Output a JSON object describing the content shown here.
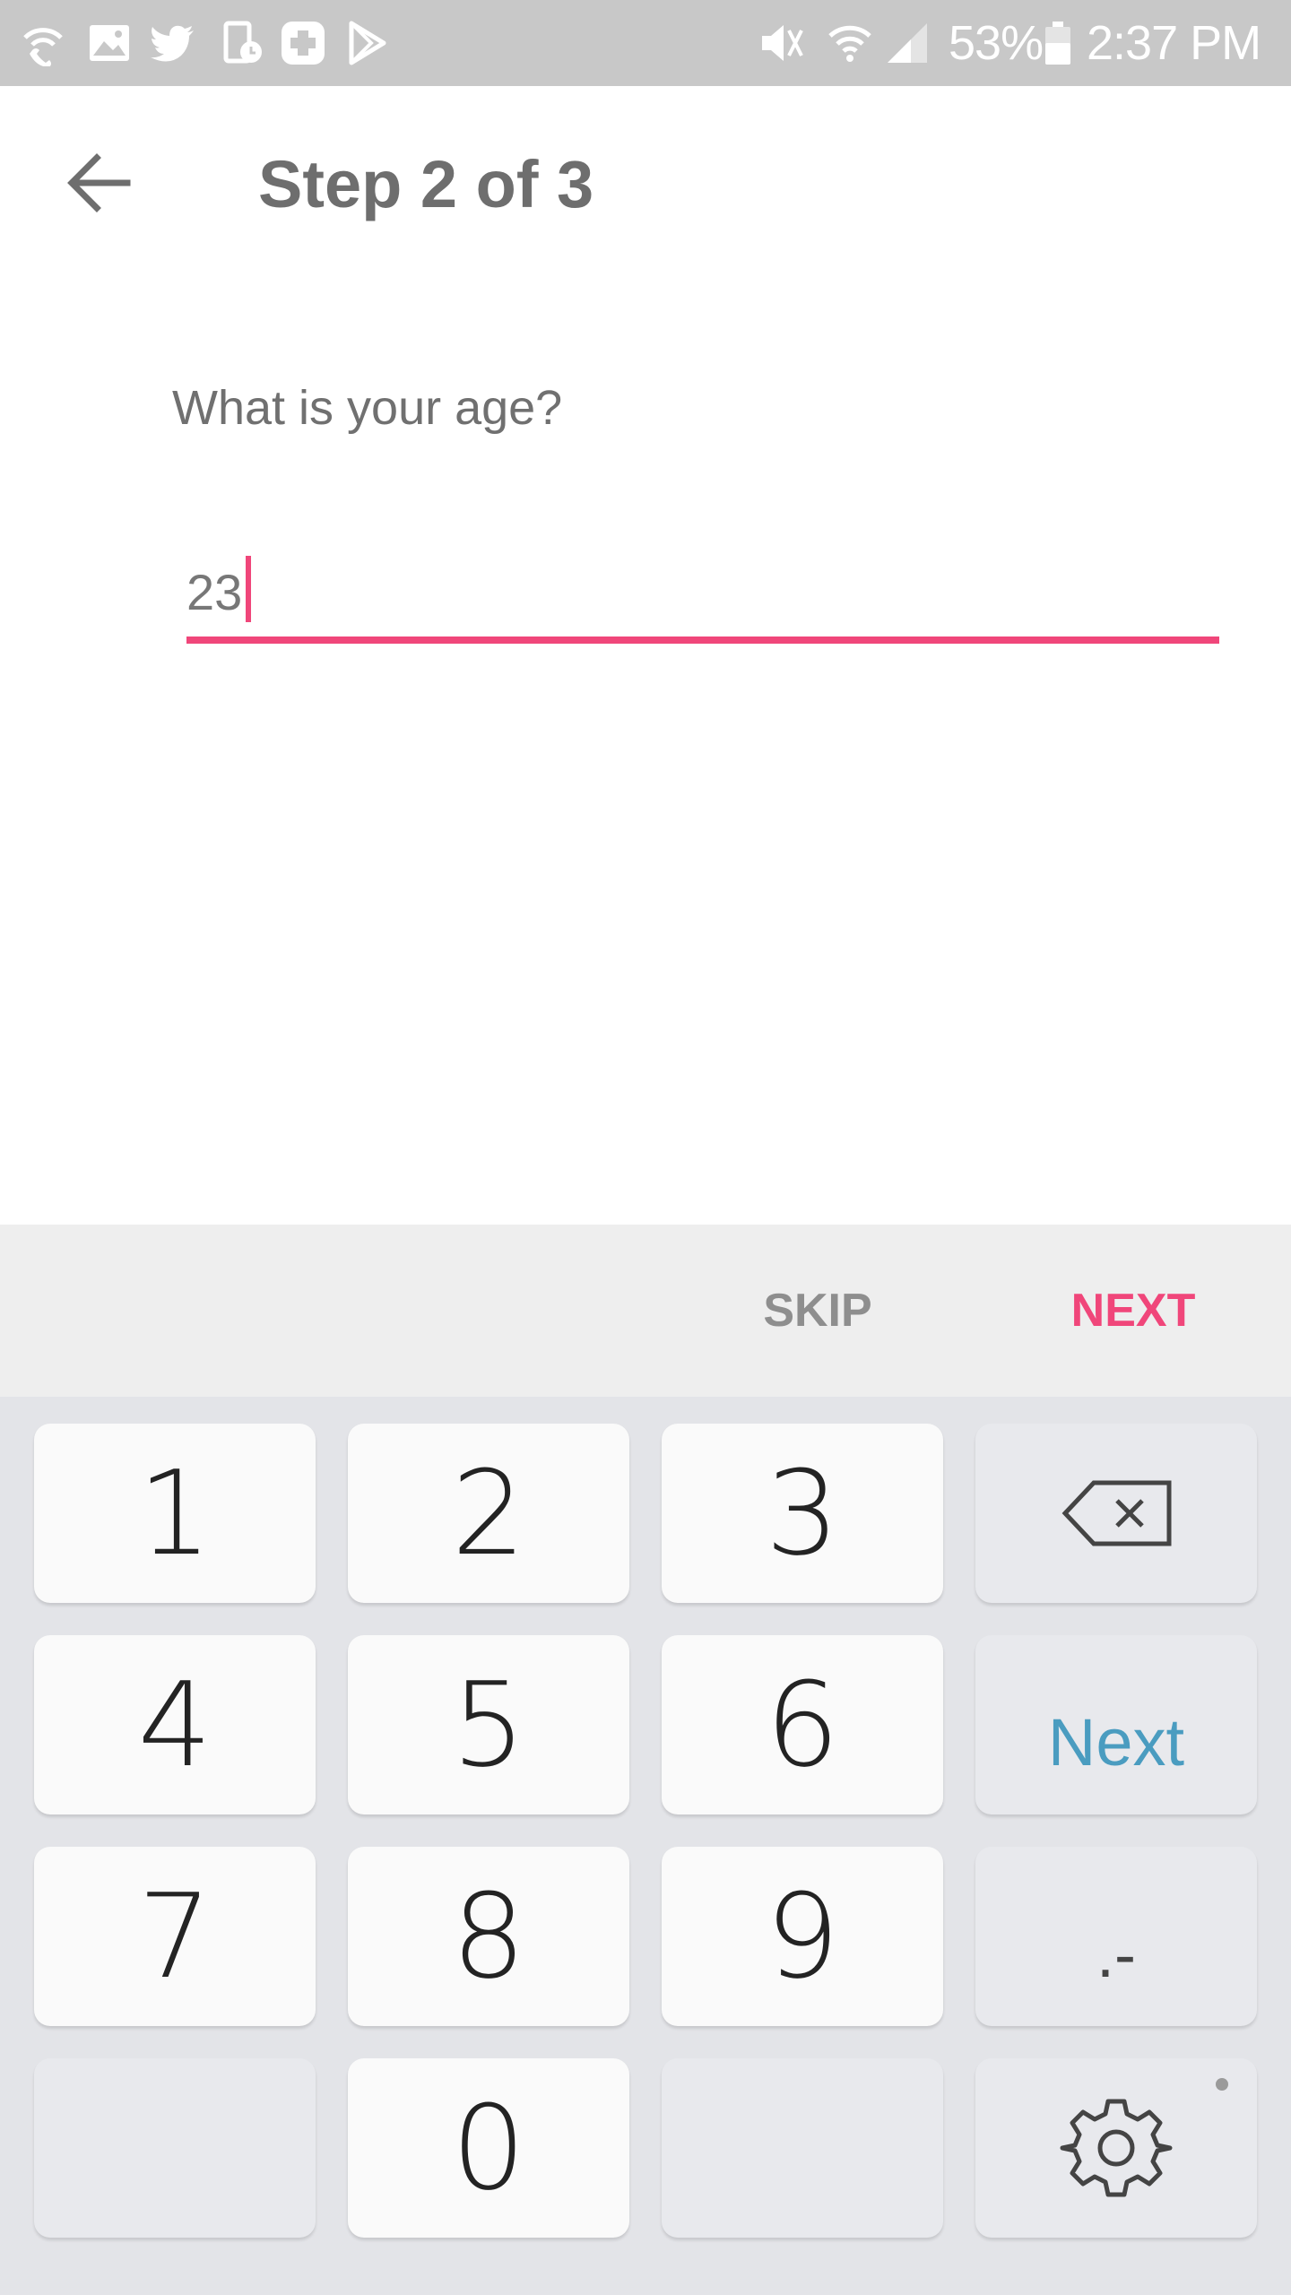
{
  "status_bar": {
    "battery": "53%",
    "time": "2:37 PM",
    "left_icons": [
      "wifi-call-icon",
      "image-icon",
      "twitter-icon",
      "usage-icon",
      "health-icon",
      "play-store-icon"
    ],
    "right_icons": [
      "mute-vibrate-icon",
      "wifi-icon",
      "signal-icon",
      "battery-icon"
    ]
  },
  "toolbar": {
    "title": "Step 2 of 3",
    "back_icon": "arrow-back-icon"
  },
  "form": {
    "question": "What is your age?",
    "age_value": "23"
  },
  "actions": {
    "skip_label": "SKIP",
    "next_label": "NEXT"
  },
  "keyboard": {
    "keys": {
      "k1": "1",
      "k2": "2",
      "k3": "3",
      "k4": "4",
      "k5": "5",
      "k6": "6",
      "k7": "7",
      "k8": "8",
      "k9": "9",
      "k0": "0"
    },
    "next_label": "Next",
    "dot_dash_label": ".-",
    "backspace_icon": "backspace-icon",
    "settings_icon": "gear-icon"
  },
  "colors": {
    "accent": "#f0467a",
    "status_bar": "#c8c8c8",
    "keyboard_bg": "#e3e4e8",
    "next_key_text": "#4a9cc0"
  }
}
